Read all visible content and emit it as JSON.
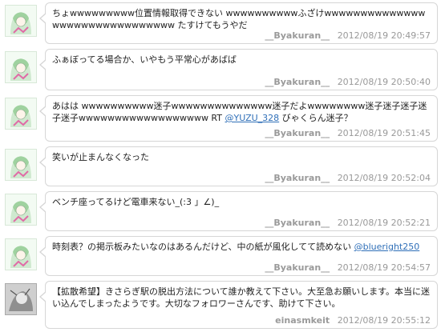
{
  "tweets": [
    {
      "text": "ちょwwwwwwwww位置情報取得できない wwwwwwwwwwふざけwwwwwwwwwwwwwwwwwwwwwwwwwwwwwww たすけてもうやだ",
      "mention": "",
      "user": "__Byakuran__",
      "time": "2012/08/19 20:49:57"
    },
    {
      "text": "ふぁぼってる場合か、いやもう平常心があばば",
      "mention": "",
      "user": "__Byakuran__",
      "time": "2012/08/19 20:50:40"
    },
    {
      "text": "あはは wwwwwwwwww迷子wwwwwwwwwwwwww迷子だよwwwwwwww迷子迷子迷子迷子迷子wwwwwwwwwwwwwwwwww RT ",
      "mention": "@YUZU_328",
      "text_after": " びゃくらん迷子？",
      "user": "__Byakuran__",
      "time": "2012/08/19 20:51:45"
    },
    {
      "text": "笑いが止まんなくなった",
      "mention": "",
      "user": "__Byakuran__",
      "time": "2012/08/19 20:52:04"
    },
    {
      "text": "ベンチ座ってるけど電車来ない_(:3 」∠)_",
      "mention": "",
      "user": "__Byakuran__",
      "time": "2012/08/19 20:52:21"
    },
    {
      "text": "時刻表？の掲示板みたいなのはあるんだけど、中の紙が風化してて読めない ",
      "mention": "@blueright250",
      "user": "__Byakuran__",
      "time": "2012/08/19 20:54:57"
    },
    {
      "text": "【拡散希望】きさらぎ駅の脱出方法について誰か教えて下さい。大至急お願いします。本当に迷い込んでしまったようです。大切なフォロワーさんです、助けて下さい。",
      "mention": "",
      "user": "einasmkeit",
      "time": "2012/08/19 20:55:12"
    }
  ],
  "colors": {
    "mention": "#2f6fb8",
    "meta": "#999999",
    "border": "#d6d6d6"
  }
}
